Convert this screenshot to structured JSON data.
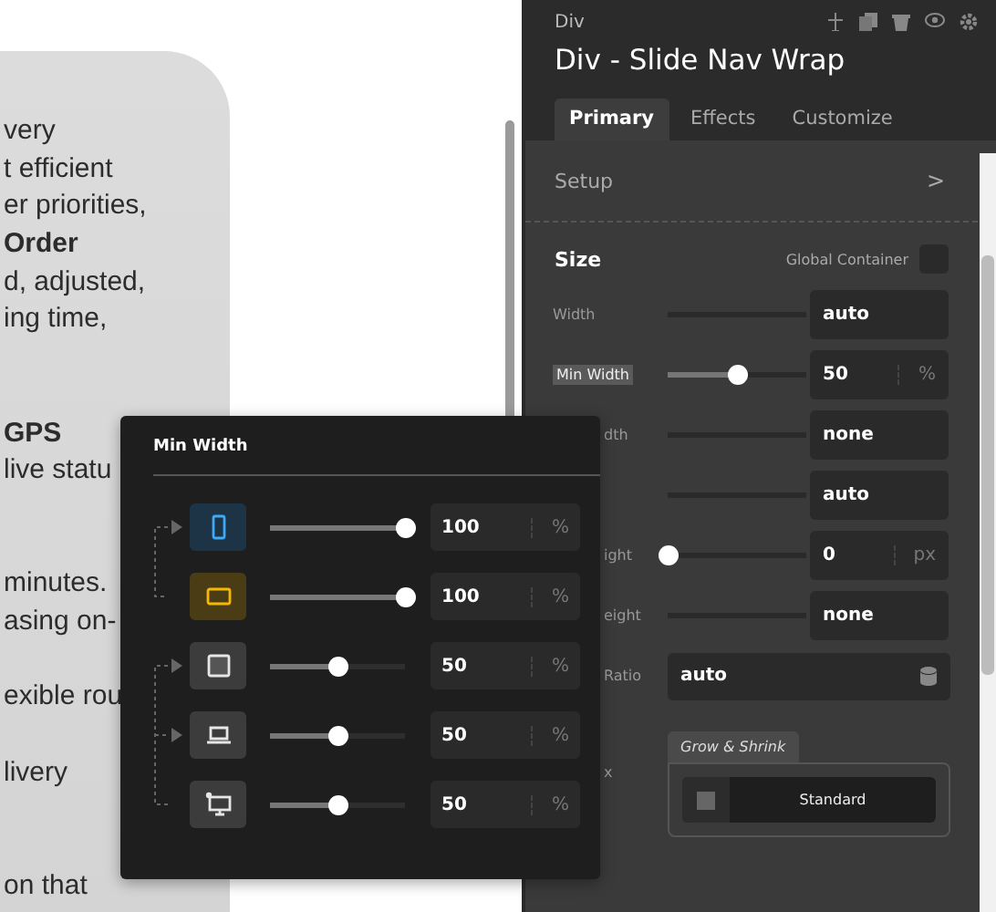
{
  "document": {
    "lines": [
      {
        "text": "very",
        "kind": "text"
      },
      {
        "text": "t efficient",
        "kind": "text"
      },
      {
        "text": "er priorities,",
        "kind": "text"
      },
      {
        "text": "Order",
        "kind": "heading"
      },
      {
        "text": "d, adjusted,",
        "kind": "text"
      },
      {
        "text": "ing time,",
        "kind": "text"
      },
      {
        "text": "GPS",
        "kind": "heading"
      },
      {
        "text": "live statu",
        "kind": "text"
      },
      {
        "text": "minutes.",
        "kind": "text"
      },
      {
        "text": "asing on-",
        "kind": "text"
      },
      {
        "text": "exible rou",
        "kind": "text"
      },
      {
        "text": "livery",
        "kind": "text"
      },
      {
        "text": "on that",
        "kind": "text"
      }
    ]
  },
  "panel": {
    "element_type": "Div",
    "title": "Div - Slide Nav Wrap",
    "tabs": [
      {
        "label": "Primary",
        "selected": true
      },
      {
        "label": "Effects",
        "selected": false
      },
      {
        "label": "Customize",
        "selected": false
      }
    ],
    "setup": {
      "label": "Setup",
      "chevron": ">"
    },
    "size": {
      "heading": "Size",
      "global_container": "Global Container",
      "rows": [
        {
          "label": "Width",
          "kind": "input",
          "value": "auto"
        },
        {
          "label": "Min Width",
          "kind": "slider",
          "level": 0.5,
          "value": "50",
          "unit": "%"
        },
        {
          "label": "dth",
          "kind": "input",
          "value": "none"
        },
        {
          "kind": "input",
          "value": "auto"
        },
        {
          "label": "ight",
          "kind": "slider",
          "level": 0,
          "value": "0",
          "unit": "px"
        },
        {
          "label": "eight",
          "kind": "input",
          "value": "none"
        },
        {
          "label": "Ratio",
          "kind": "select",
          "value": "auto"
        },
        {
          "label": "x",
          "kind": "flex",
          "tab": "Grow & Shrink",
          "value": "Standard"
        }
      ]
    }
  },
  "popup": {
    "title": "Min Width",
    "rows": [
      {
        "kind": "phone-portrait",
        "color": "#3fa9f5",
        "level": 1,
        "value": "100",
        "unit": "%"
      },
      {
        "kind": "phone-landscape",
        "color": "#f5b800",
        "level": 1,
        "value": "100",
        "unit": "%"
      },
      {
        "kind": "tablet",
        "color": "#e6e6e6",
        "level": 0.5,
        "value": "50",
        "unit": "%"
      },
      {
        "kind": "laptop",
        "color": "#e6e6e6",
        "level": 0.5,
        "value": "50",
        "unit": "%"
      },
      {
        "kind": "desktop",
        "color": "#e6e6e6",
        "level": 0.5,
        "value": "50",
        "unit": "%"
      }
    ]
  }
}
